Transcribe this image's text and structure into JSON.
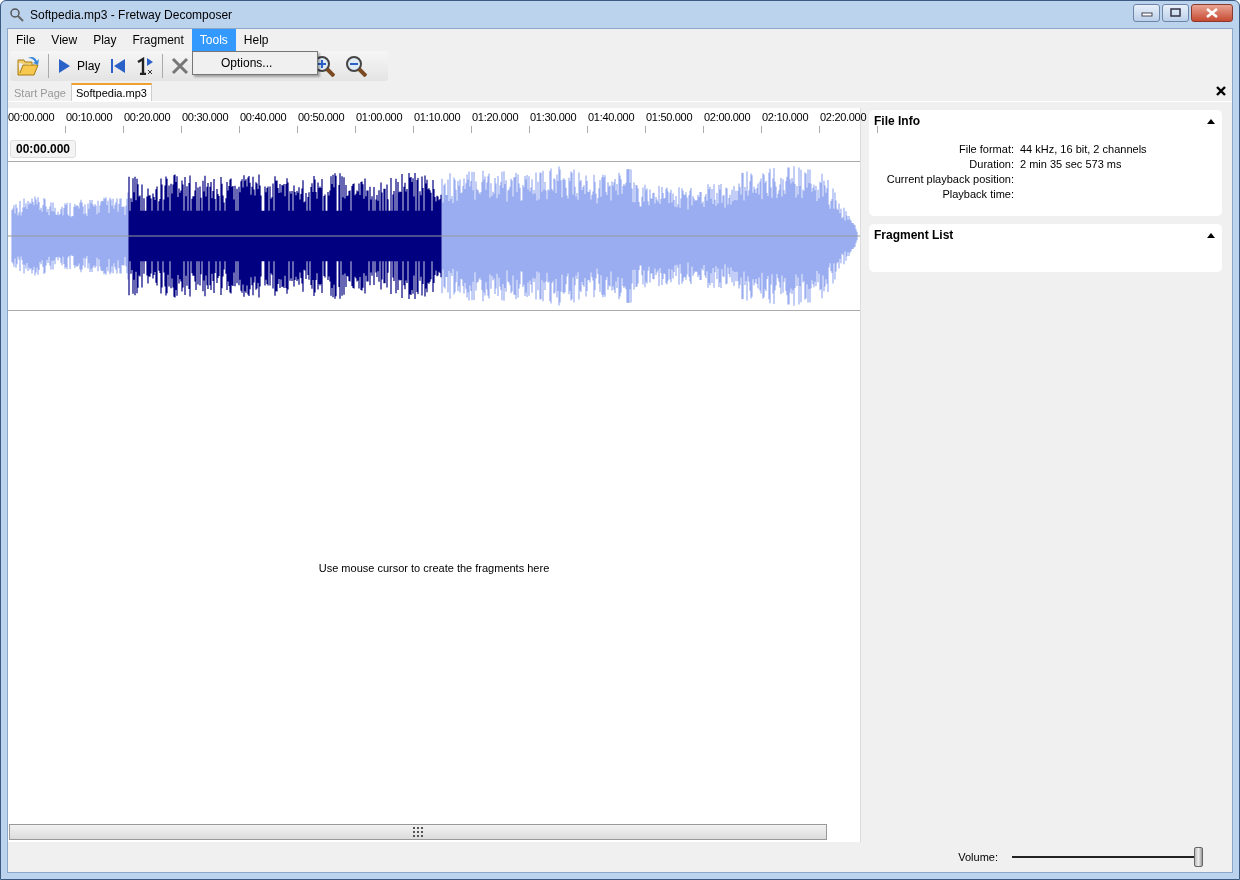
{
  "window": {
    "title": "Softpedia.mp3 - Fretway Decomposer"
  },
  "menu": [
    {
      "label": "File",
      "selected": false
    },
    {
      "label": "View",
      "selected": false
    },
    {
      "label": "Play",
      "selected": false
    },
    {
      "label": "Fragment",
      "selected": false
    },
    {
      "label": "Tools",
      "selected": true
    },
    {
      "label": "Help",
      "selected": false
    }
  ],
  "open_menu": {
    "items": [
      {
        "label": "Options..."
      }
    ]
  },
  "toolbar": [
    {
      "kind": "open"
    },
    {
      "kind": "separator"
    },
    {
      "kind": "play",
      "label": "Play"
    },
    {
      "kind": "to-start"
    },
    {
      "kind": "speed"
    },
    {
      "kind": "separator"
    },
    {
      "kind": "cut"
    },
    {
      "kind": "gap"
    },
    {
      "kind": "zoom-in"
    },
    {
      "kind": "zoom-out"
    }
  ],
  "tabs": [
    {
      "label": "Start Page",
      "selected": false
    },
    {
      "label": "Softpedia.mp3",
      "selected": true
    }
  ],
  "editor": {
    "ruler": [
      "00:00.000",
      "00:10.000",
      "00:20.000",
      "00:30.000",
      "00:40.000",
      "00:50.000",
      "01:00.000",
      "01:10.000",
      "01:20.000",
      "01:30.000",
      "01:40.000",
      "01:50.000",
      "02:00.000",
      "02:10.000",
      "02:20.000"
    ],
    "position": "00:00.000",
    "hint": "Use mouse cursor to create the fragments here"
  },
  "panels": [
    {
      "title": "File Info",
      "expanded": true,
      "rows": [
        {
          "label": "File format:",
          "value": "44 kHz, 16 bit, 2 channels"
        },
        {
          "label": "Duration:",
          "value": "2 min 35 sec 573 ms"
        },
        {
          "label": "Current playback position:"
        },
        {
          "label": "Playback time:"
        }
      ]
    },
    {
      "title": "Fragment List",
      "expanded": true
    }
  ],
  "status_bar": {
    "volume_label": "Volume:",
    "volume": {
      "level": 0.98
    }
  }
}
